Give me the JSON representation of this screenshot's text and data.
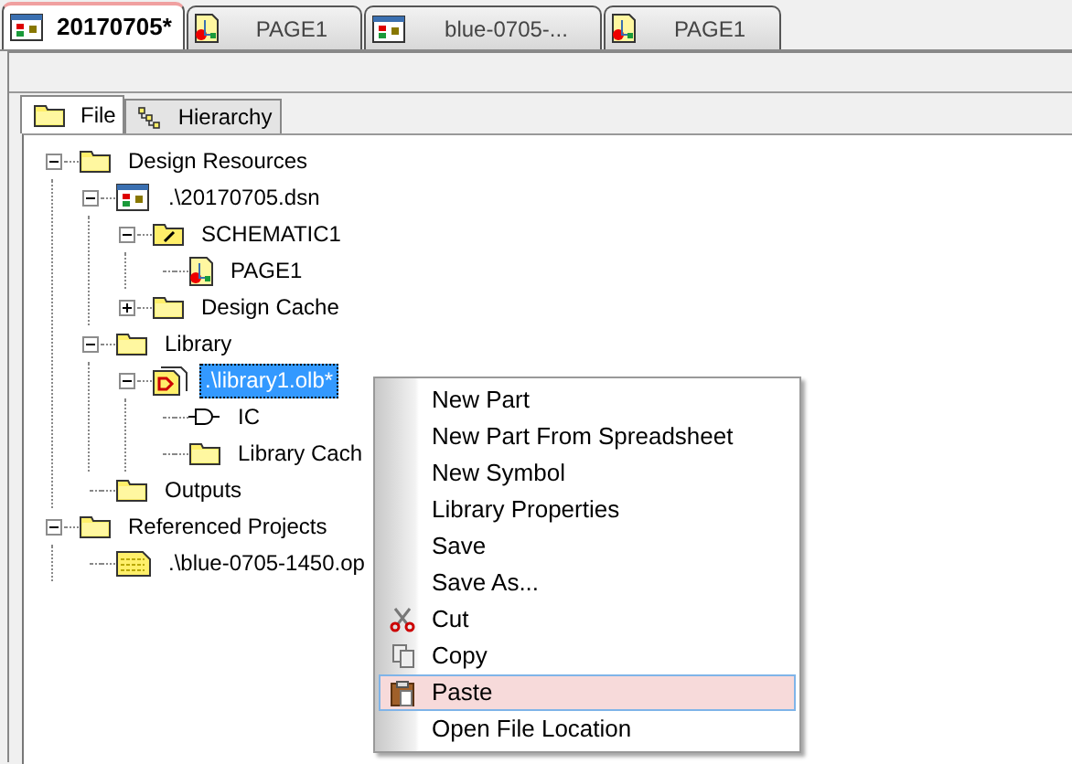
{
  "document_tabs": [
    {
      "label": "20170705*",
      "kind": "design",
      "selected": true
    },
    {
      "label": "PAGE1",
      "kind": "page",
      "selected": false
    },
    {
      "label": "blue-0705-...",
      "kind": "design",
      "selected": false
    },
    {
      "label": "PAGE1",
      "kind": "page",
      "selected": false
    }
  ],
  "panel_tabs": [
    {
      "label": "File",
      "kind": "folder",
      "selected": true
    },
    {
      "label": "Hierarchy",
      "kind": "hierarchy",
      "selected": false
    }
  ],
  "tree": [
    {
      "label": "Design Resources",
      "kind": "folder",
      "expanded": true,
      "selected": false,
      "children": [
        {
          "label": ".\\20170705.dsn",
          "kind": "design",
          "expanded": true,
          "selected": false,
          "children": [
            {
              "label": "SCHEMATIC1",
              "kind": "schematic",
              "expanded": true,
              "selected": false,
              "children": [
                {
                  "label": "PAGE1",
                  "kind": "page",
                  "selected": false
                }
              ]
            },
            {
              "label": "Design Cache",
              "kind": "folder",
              "expanded": false,
              "selected": false
            }
          ]
        },
        {
          "label": "Library",
          "kind": "folder",
          "expanded": true,
          "selected": false,
          "children": [
            {
              "label": ".\\library1.olb*",
              "kind": "library",
              "expanded": true,
              "selected": true,
              "children": [
                {
                  "label": "IC",
                  "kind": "part",
                  "selected": false
                },
                {
                  "label": "Library Cach",
                  "kind": "folder",
                  "selected": false
                }
              ]
            }
          ]
        },
        {
          "label": "Outputs",
          "kind": "folder",
          "selected": false
        }
      ]
    },
    {
      "label": "Referenced Projects",
      "kind": "folder",
      "expanded": true,
      "selected": false,
      "children": [
        {
          "label": ".\\blue-0705-1450.op",
          "kind": "project",
          "selected": false
        }
      ]
    }
  ],
  "context_menu": [
    {
      "label": "New Part",
      "selected": false
    },
    {
      "label": "New Part From Spreadsheet",
      "selected": false
    },
    {
      "label": "New Symbol",
      "selected": false
    },
    {
      "label": "Library Properties",
      "selected": false
    },
    {
      "label": "Save",
      "selected": false
    },
    {
      "label": "Save As...",
      "selected": false
    },
    {
      "label": "Cut",
      "kind": "cut",
      "selected": false
    },
    {
      "label": "Copy",
      "kind": "copy",
      "selected": false
    },
    {
      "label": "Paste",
      "kind": "paste",
      "selected": true
    },
    {
      "label": "Open File Location",
      "selected": false
    }
  ]
}
